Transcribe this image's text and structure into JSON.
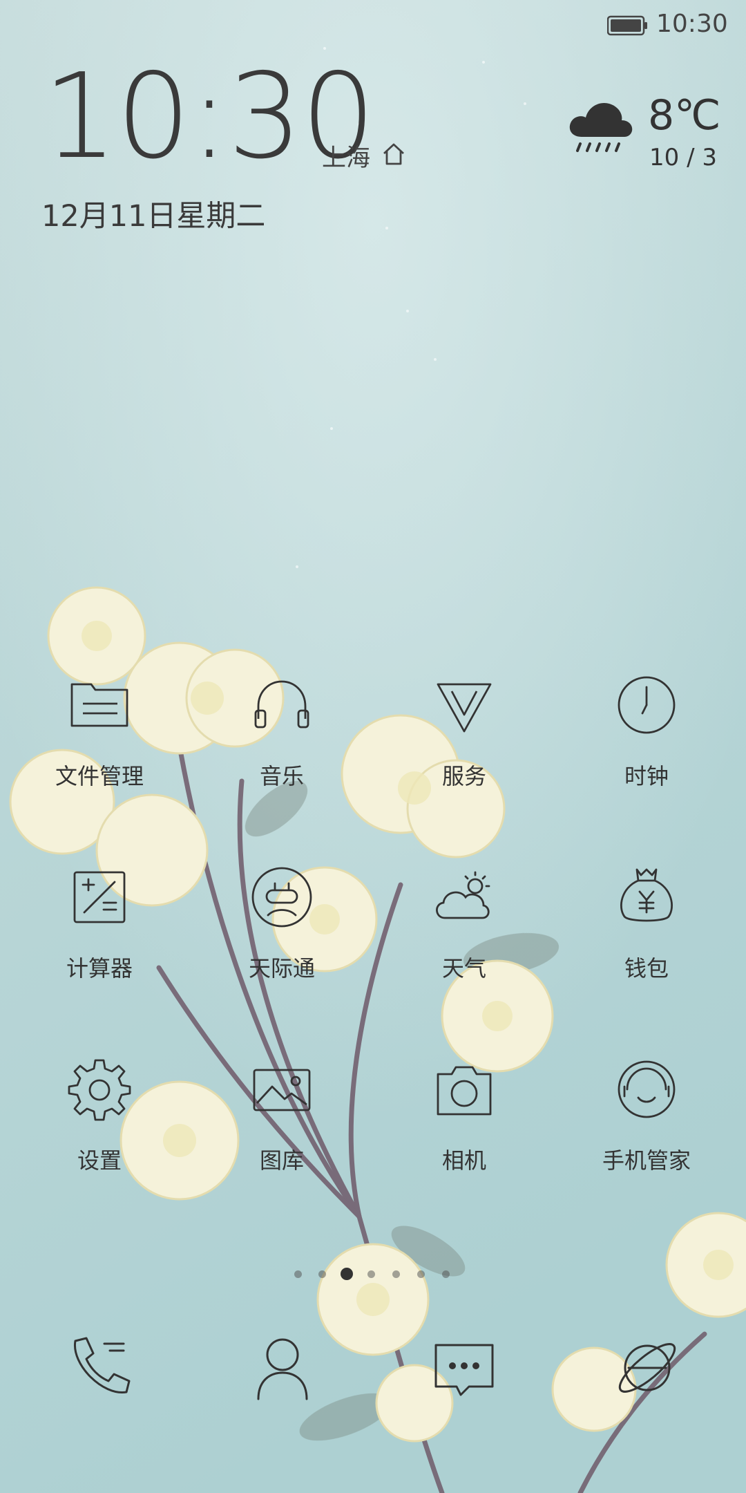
{
  "status_bar": {
    "time": "10:30",
    "battery_icon": "battery-icon"
  },
  "clock_widget": {
    "time": "10:30",
    "location": "上海",
    "date": "12月11日星期二"
  },
  "weather_widget": {
    "temperature": "8℃",
    "range": "10 / 3",
    "icon": "rain-cloud-icon"
  },
  "apps": [
    {
      "label": "文件管理",
      "icon": "folder-icon"
    },
    {
      "label": "音乐",
      "icon": "headphones-icon"
    },
    {
      "label": "服务",
      "icon": "diamond-icon"
    },
    {
      "label": "时钟",
      "icon": "clock-icon"
    },
    {
      "label": "计算器",
      "icon": "calculator-icon"
    },
    {
      "label": "天际通",
      "icon": "roaming-icon"
    },
    {
      "label": "天气",
      "icon": "weather-icon"
    },
    {
      "label": "钱包",
      "icon": "wallet-icon"
    },
    {
      "label": "设置",
      "icon": "gear-icon"
    },
    {
      "label": "图库",
      "icon": "gallery-icon"
    },
    {
      "label": "相机",
      "icon": "camera-icon"
    },
    {
      "label": "手机管家",
      "icon": "phone-manager-icon"
    }
  ],
  "page_indicator": {
    "pages": 7,
    "current": 3
  },
  "dock": [
    {
      "icon": "phone-icon"
    },
    {
      "icon": "contacts-icon"
    },
    {
      "icon": "messages-icon"
    },
    {
      "icon": "browser-icon"
    }
  ],
  "colors": {
    "background": "#bcd8d8",
    "blossom": "#f4f1d8",
    "icon_stroke": "#333333"
  }
}
